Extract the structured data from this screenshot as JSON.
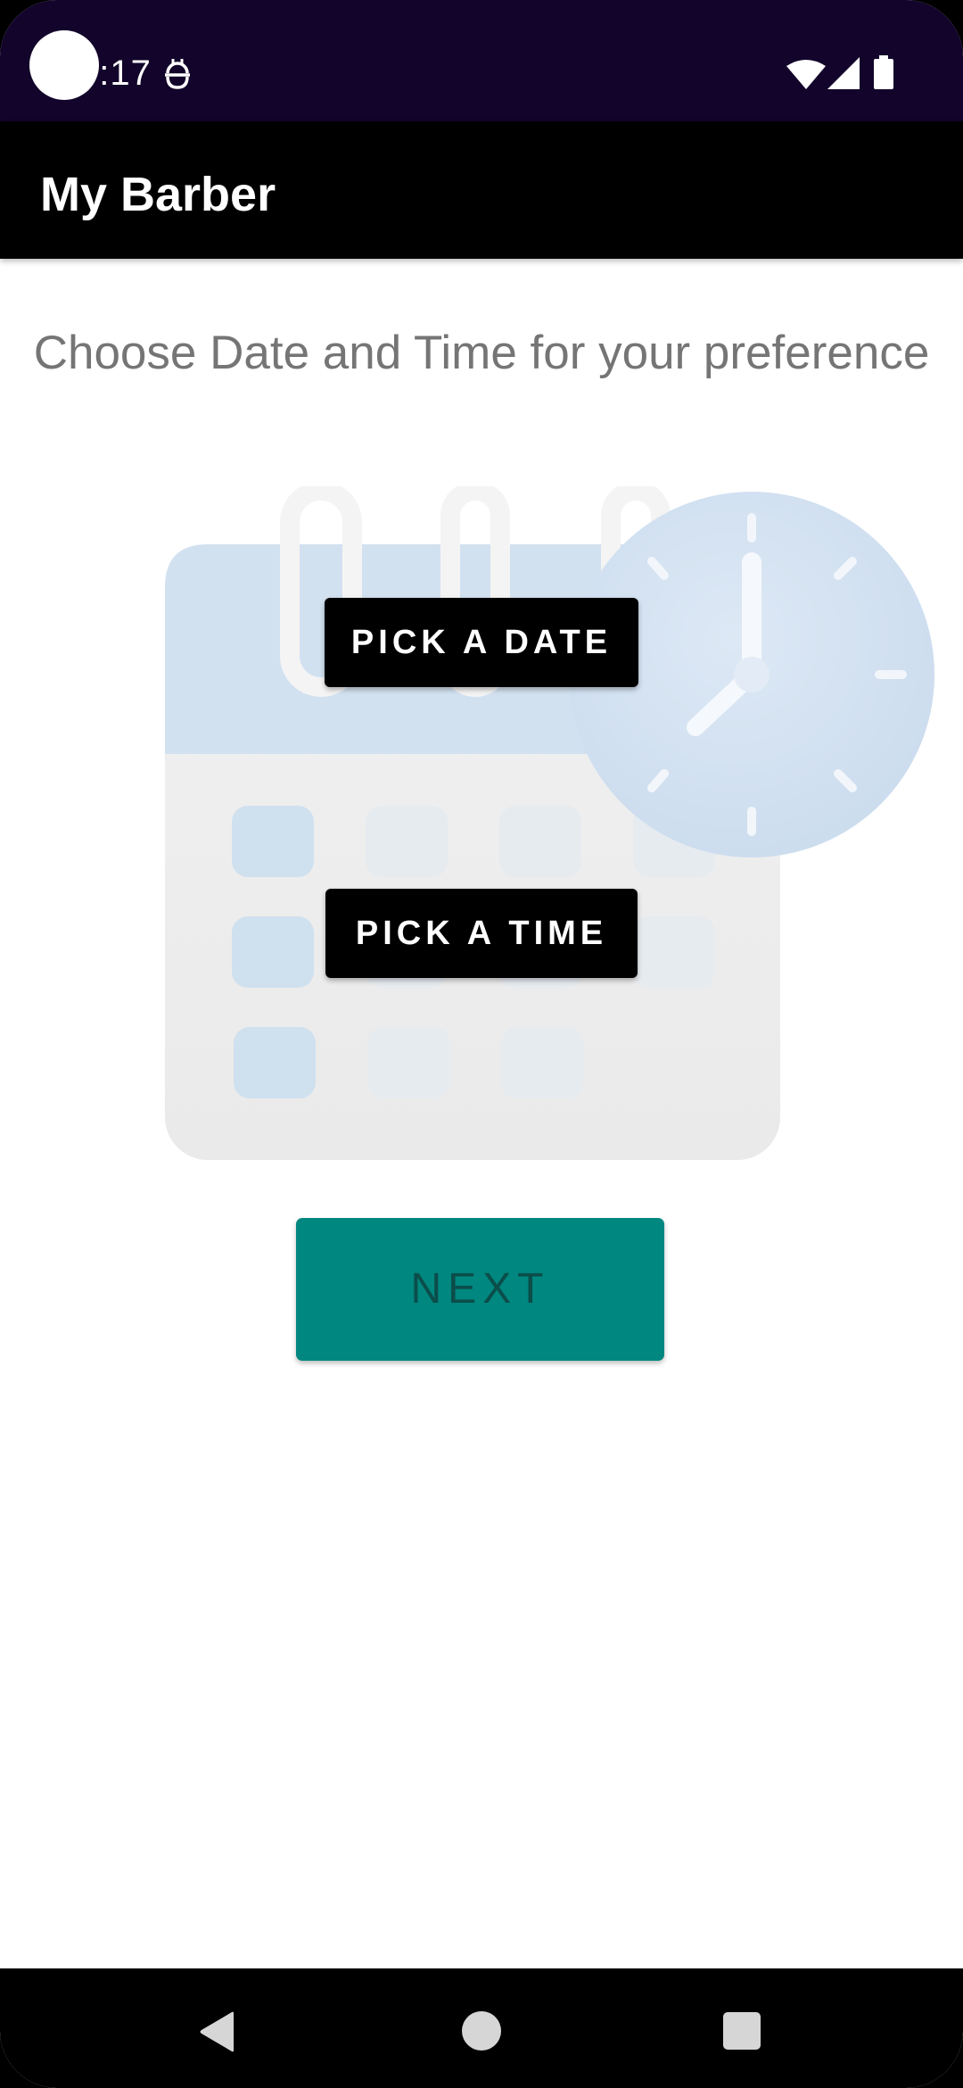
{
  "status_bar": {
    "time": "7:17",
    "icons": [
      "notification-icon",
      "wifi-icon",
      "signal-icon",
      "battery-icon"
    ]
  },
  "app_bar": {
    "title": "My Barber"
  },
  "main": {
    "prompt": "Choose Date and Time for your preference",
    "illustration": "calendar-clock-illustration",
    "pick_date_label": "PICK A DATE",
    "pick_time_label": "PICK A TIME",
    "next_label": "NEXT"
  },
  "nav_bar": {
    "icons": [
      "back-icon",
      "home-icon",
      "recents-icon"
    ]
  },
  "colors": {
    "status_bar_bg": "#12042a",
    "app_bar_bg": "#000000",
    "next_button_bg": "#00877f",
    "next_button_text": "#0b4d4a",
    "prompt_text": "#757575"
  }
}
